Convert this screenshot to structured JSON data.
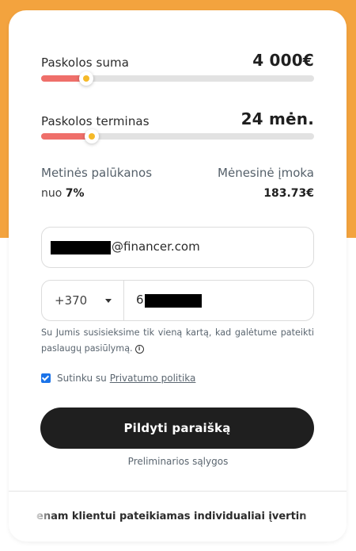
{
  "loan_amount": {
    "label": "Paskolos suma",
    "value": "4 000€",
    "slider_fraction": 0.165
  },
  "loan_term": {
    "label": "Paskolos terminas",
    "value": "24 mėn.",
    "slider_fraction": 0.185
  },
  "interest": {
    "title": "Metinės palūkanos",
    "prefix": "nuo",
    "value": "7%"
  },
  "monthly": {
    "title": "Mėnesinė įmoka",
    "value": "183.73€"
  },
  "email": {
    "domain": "@financer.com"
  },
  "phone": {
    "prefix": "+370",
    "value_start": "6"
  },
  "note": {
    "text": "Su Jumis susisieksime tik vieną kartą, kad galėtume pateikti paslaugų pasiūlymą."
  },
  "consent": {
    "text": "Sutinku su",
    "link": "Privatumo politika",
    "checked": true
  },
  "submit": {
    "label": "Pildyti paraišką"
  },
  "preliminary": {
    "label": "Preliminarios sąlygos"
  },
  "ticker": {
    "text": "enam klientui pateikiamas individualiai įvertin"
  },
  "colors": {
    "accent_orange": "#f3a33e",
    "slider_fill": "#ef6f6a",
    "thumb_dot": "#f5b928",
    "checkbox": "#1b73e8",
    "button": "#1f1f1f"
  }
}
